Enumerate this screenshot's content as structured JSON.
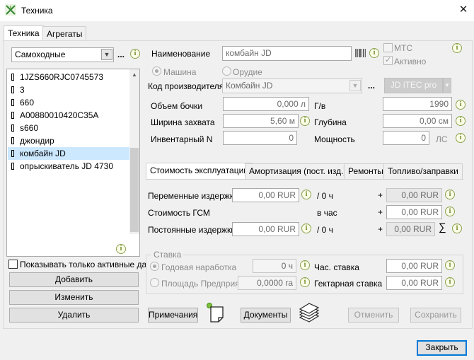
{
  "window": {
    "title": "Техника"
  },
  "tabs": [
    "Техника",
    "Агрегаты"
  ],
  "left": {
    "filter_value": "Самоходные",
    "ellipsis": "...",
    "items": [
      "1JZS660RJC0745573",
      "3",
      "660",
      "A00880010420C35A",
      "s660",
      "джондир",
      "комбайн JD",
      "опрыскиватель JD 4730"
    ],
    "selected_index": 6,
    "show_active_label": "Показывать только активные да",
    "add_label": "Добавить",
    "edit_label": "Изменить",
    "delete_label": "Удалить"
  },
  "form": {
    "name_label": "Наименование",
    "name_value": "комбайн JD",
    "mts_label": "МТС",
    "active_label": "Активно",
    "active_checked": true,
    "mts_checked": false,
    "machine_label": "Машина",
    "tool_label": "Орудие",
    "maker_label": "Код производителя",
    "maker_value": "Комбайн JD",
    "maker_ellipsis": "...",
    "jd_button": "JD iTEC pro",
    "tank_label": "Объем бочки",
    "tank_value": "0,000 л",
    "year_label": "Г/в",
    "year_value": "1990",
    "width_label": "Ширина захвата",
    "width_value": "5,60 м",
    "depth_label": "Глубина",
    "depth_value": "0,00 см",
    "inv_label": "Инвентарный N",
    "inv_value": "0",
    "power_label": "Мощность",
    "power_value": "0",
    "power_unit": "ЛС"
  },
  "cost_tabs": [
    "Стоимость эксплуатации",
    "Амортизация (пост. изд.)",
    "Ремонты",
    "Топливо/заправки"
  ],
  "costs": {
    "var_label": "Переменные издержки",
    "var_value": "0,00 RUR",
    "var_per": "/ 0 ч",
    "var_total": "0,00 RUR",
    "fuel_label": "Стоимость ГСМ",
    "fuel_per": "в час",
    "fuel_total": "0,00 RUR",
    "fixed_label": "Постоянные издержки",
    "fixed_value": "0,00 RUR",
    "fixed_per": "/ 0 ч",
    "fixed_total": "0,00 RUR",
    "plus": "+",
    "sum": "∑"
  },
  "rate": {
    "title": "Ставка",
    "annual_label": "Годовая наработка",
    "annual_value": "0 ч",
    "area_label": "Площадь Предприяти",
    "area_value": "0,0000 га",
    "hour_rate_label": "Час. ставка",
    "hour_rate_value": "0,00 RUR",
    "ha_rate_label": "Гектарная ставка",
    "ha_rate_value": "0,00 RUR"
  },
  "bottom": {
    "notes_label": "Примечания",
    "docs_label": "Документы",
    "cancel_label": "Отменить",
    "save_label": "Сохранить",
    "close_label": "Закрыть"
  },
  "info_glyph": "i",
  "colors": {
    "selection": "#cce8ff",
    "accent": "#0078d7",
    "info": "#8aa34f"
  }
}
